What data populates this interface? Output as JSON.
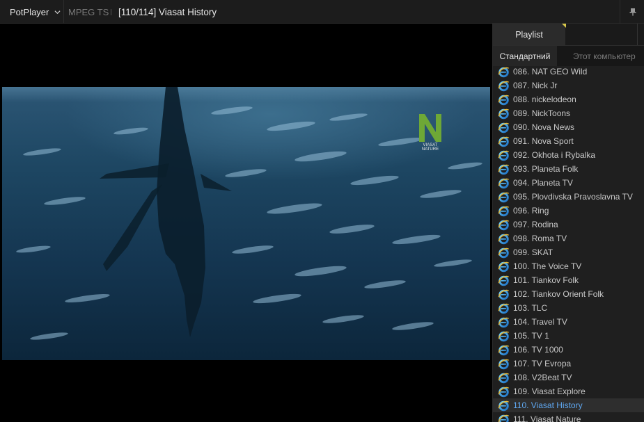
{
  "titlebar": {
    "app_name": "PotPlayer",
    "format": "MPEG TS",
    "title": "[110/114] Viasat History"
  },
  "video": {
    "channel_logo_text": [
      "VIASAT",
      "NATURE"
    ]
  },
  "playlist": {
    "tab_label": "Playlist",
    "subtabs": [
      "Стандартний",
      "Этот компьютер"
    ],
    "items": [
      "086. NAT GEO Wild",
      "087. Nick Jr",
      "088. nickelodeon",
      "089. NickToons",
      "090. Nova News",
      "091. Nova Sport",
      "092. Okhota i Rybalka",
      "093. Planeta Folk",
      "094. Planeta TV",
      "095. Plovdivska Pravoslavna TV",
      "096. Ring",
      "097. Rodina",
      "098. Roma TV",
      "099. SKAT",
      "100. The Voice TV",
      "101. Tiankov Folk",
      "102. Tiankov Orient Folk",
      "103. TLC",
      "104. Travel TV",
      "105. TV 1",
      "106. TV 1000",
      "107. TV Evropa",
      "108. V2Beat TV",
      "109. Viasat Explore",
      "110. Viasat History",
      "111. Viasat Nature"
    ],
    "selected_index": 24,
    "selected_color": "#5fa7f0"
  }
}
